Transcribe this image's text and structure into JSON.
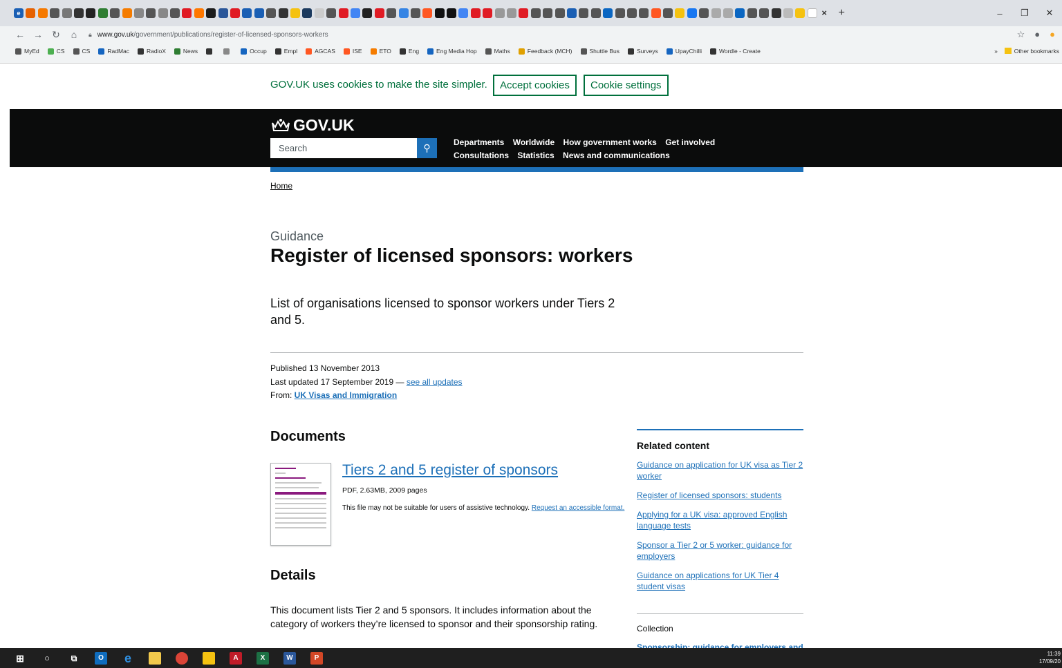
{
  "browser": {
    "tab_close": "×",
    "new_tab": "+",
    "window_controls": [
      "–",
      "❐",
      "✕"
    ],
    "url_host": "www.gov.uk",
    "url_path": "/government/publications/register-of-licensed-sponsors-workers",
    "bookmarks": [
      "MyEd",
      "CS",
      "CS",
      "RadMac",
      "RadioX",
      "News",
      "",
      "",
      "Occup",
      "Empl",
      "AGCAS",
      "ISE",
      "ETO",
      "Eng",
      "Eng Media Hop",
      "Maths",
      "Feedback (MCH)",
      "Shuttle Bus",
      "Surveys",
      "UpayChilli",
      "Wordle - Create"
    ],
    "bookmarks_overflow": "»",
    "other_bookmarks": "Other bookmarks"
  },
  "cookie_banner": {
    "text": "GOV.UK uses cookies to make the site simpler.",
    "accept_label": "Accept cookies",
    "settings_label": "Cookie settings"
  },
  "header": {
    "logo": "GOV.UK",
    "search_placeholder": "Search",
    "nav_items": [
      "Departments",
      "Worldwide",
      "How government works",
      "Get involved",
      "Consultations",
      "Statistics",
      "News and communications"
    ]
  },
  "breadcrumb": "Home",
  "page": {
    "caption": "Guidance",
    "title": "Register of licensed sponsors: workers",
    "lead": "List of organisations licensed to sponsor workers under Tiers 2 and 5.",
    "published": "Published 13 November 2013",
    "updated_prefix": "Last updated 17 September 2019 — ",
    "updated_link": "see all updates",
    "from_label": "From: ",
    "from_link": "UK Visas and Immigration"
  },
  "documents": {
    "heading": "Documents",
    "title": "Tiers 2 and 5 register of sponsors",
    "meta": "PDF, 2.63MB, 2009 pages",
    "note": "This file may not be suitable for users of assistive technology. ",
    "note_link": "Request an accessible format."
  },
  "details": {
    "heading": "Details",
    "body": "This document lists Tier 2 and 5 sponsors. It includes information about the category of workers they’re licensed to sponsor and their sponsorship rating."
  },
  "related": {
    "heading": "Related content",
    "links": [
      "Guidance on application for UK visa as Tier 2 worker",
      "Register of licensed sponsors: students",
      "Applying for a UK visa: approved English language tests",
      "Sponsor a Tier 2 or 5 worker: guidance for employers",
      "Guidance on applications for UK Tier 4 student visas"
    ],
    "collection_label": "Collection",
    "collection_link": "Sponsorship: guidance for employers and"
  },
  "taskbar": {
    "time": "11:39",
    "date": "17/09/20"
  },
  "colors": {
    "govuk_black": "#0b0c0c",
    "govuk_blue": "#1d70b8",
    "cookie_green": "#00703c"
  }
}
